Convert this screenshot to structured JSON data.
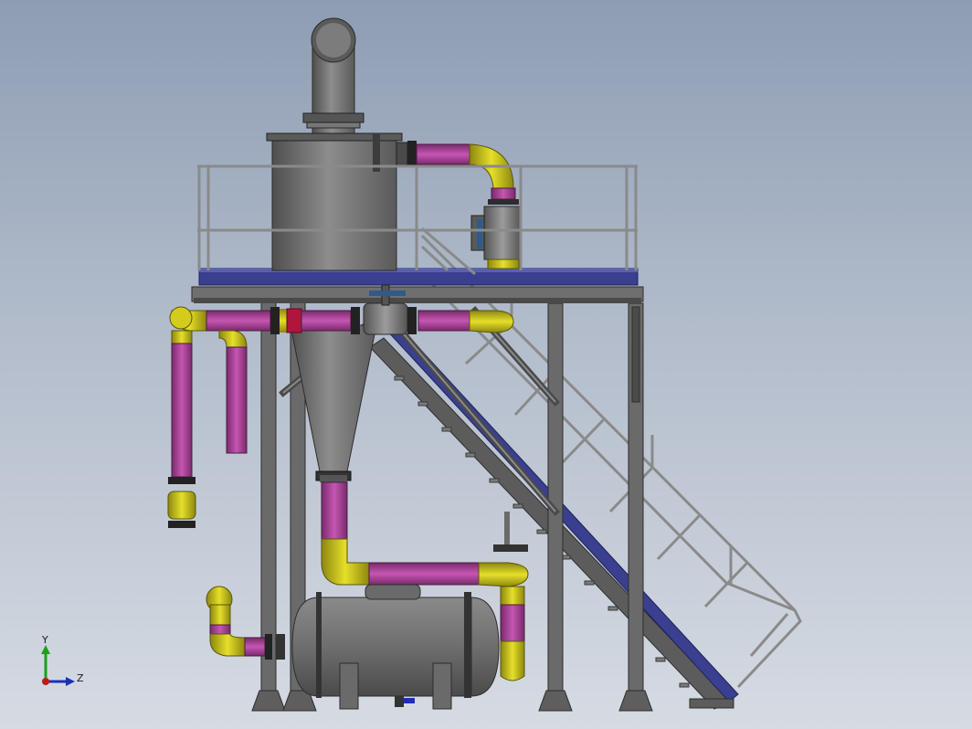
{
  "viewport": {
    "background_top": "#8e9db4",
    "background_bottom": "#d6dbe3"
  },
  "colors": {
    "steel": "#6b6b6b",
    "steel_dark": "#3c3c3c",
    "steel_light": "#9a9a9a",
    "pipe_magenta": "#b0439e",
    "pipe_magenta_dark": "#7a2a6c",
    "pipe_yellow": "#d3cc1c",
    "pipe_yellow_dark": "#8c8710",
    "deck_blue": "#3a3f8f",
    "flange_crimson": "#b0153c",
    "rail": "#8a8a8a"
  },
  "triad": {
    "y_label": "Y",
    "z_label": "Z",
    "y_color": "#1aa01a",
    "z_color": "#1d2fb5",
    "origin_color": "#c01b1b"
  }
}
